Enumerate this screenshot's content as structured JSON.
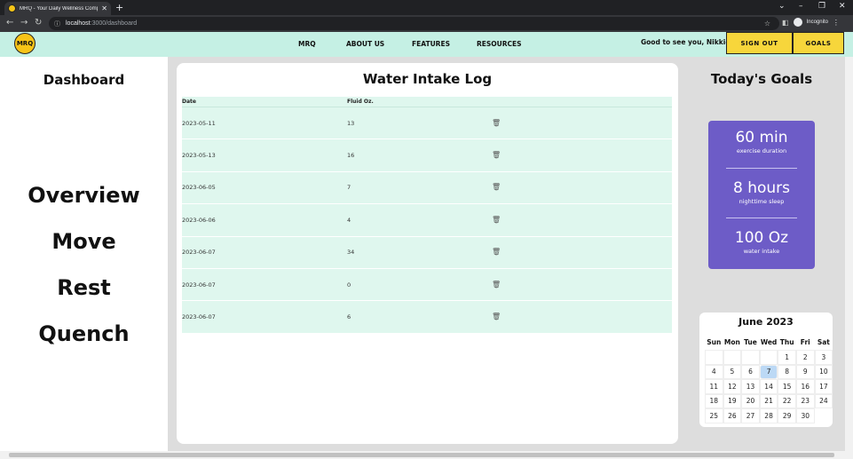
{
  "browser": {
    "tab_title": "MRQ - Your Daily Wellness Comp",
    "url_host": "localhost",
    "url_path": ":3000/dashboard",
    "incognito_label": "Incognito"
  },
  "navbar": {
    "logo_text": "MRQ",
    "links": [
      "MRQ",
      "ABOUT US",
      "FEATURES",
      "RESOURCES"
    ],
    "greeting": "Good to see you, Nikki-a",
    "sign_out": "SIGN OUT",
    "goals": "GOALS"
  },
  "sidebar": {
    "title": "Dashboard",
    "items": [
      "Overview",
      "Move",
      "Rest",
      "Quench"
    ]
  },
  "log": {
    "title": "Water Intake Log",
    "columns": [
      "Date",
      "Fluid Oz."
    ],
    "rows": [
      {
        "date": "2023-05-11",
        "oz": "13"
      },
      {
        "date": "2023-05-13",
        "oz": "16"
      },
      {
        "date": "2023-06-05",
        "oz": "7"
      },
      {
        "date": "2023-06-06",
        "oz": "4"
      },
      {
        "date": "2023-06-07",
        "oz": "34"
      },
      {
        "date": "2023-06-07",
        "oz": "0"
      },
      {
        "date": "2023-06-07",
        "oz": "6"
      }
    ]
  },
  "goals": {
    "title": "Today's Goals",
    "items": [
      {
        "value": "60 min",
        "label": "exercise duration"
      },
      {
        "value": "8 hours",
        "label": "nighttime sleep"
      },
      {
        "value": "100 Oz",
        "label": "water intake"
      }
    ],
    "accent_color": "#6d5cc7"
  },
  "calendar": {
    "title": "June 2023",
    "weekdays": [
      "Sun",
      "Mon",
      "Tue",
      "Wed",
      "Thu",
      "Fri",
      "Sat"
    ],
    "leading_blanks": 4,
    "days_in_month": 30,
    "today": 7
  }
}
